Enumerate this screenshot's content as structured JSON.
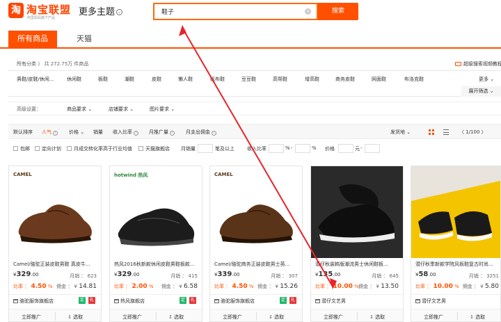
{
  "header": {
    "logo_glyph": "淘",
    "logo_text": "淘宝联盟",
    "logo_sub": "阿里妈妈旗下产品",
    "theme_link": "更多主题",
    "theme_chevron": "⌄",
    "search_value": "鞋子",
    "clear_glyph": "×",
    "search_button": "搜索"
  },
  "tabs": {
    "all": "所有商品",
    "tmall": "天猫"
  },
  "breadcrumb": {
    "all_categories": "所有分类",
    "separator": "〉",
    "count": "共 272.75万 件商品"
  },
  "super_search": "超级搜索视频教程",
  "categories": [
    "男鞋/皮鞋/休闲...",
    "休闲鞋",
    "板鞋",
    "潮鞋",
    "皮鞋",
    "懒人鞋",
    "帆布鞋",
    "豆豆鞋",
    "高帮鞋",
    "增高鞋",
    "商务皮鞋",
    "网面鞋",
    "布洛克鞋"
  ],
  "cat_more": "更多",
  "cat_more_chevron": "⌄",
  "expand_filter": "展开筛选 ⌄",
  "advanced": {
    "label": "高级设置：",
    "items": [
      "商品要求 ⌄",
      "店铺要求 ⌄",
      "图片要求 ⌄"
    ]
  },
  "sortbar": {
    "default": "默认排序",
    "popularity": "人气",
    "price": "价格 ⌄",
    "sales": "销量",
    "income_ratio": "收入比率",
    "monthly_promo": "月推广量",
    "monthly_payout": "月支出佣金",
    "ship_from": "发货地 ⌄",
    "pager": "〈   1/100   〉",
    "info_glyph": "i"
  },
  "filters": {
    "free_shipping": "包邮",
    "targeted_plan": "定向计划",
    "monthly_conversion": "月成交转化率高于行业均值",
    "tmall_flagship": "天猫旗舰店",
    "monthly_sales": "月销量",
    "pen_above": "笔及以上",
    "income_ratio": "收入比率",
    "percent1": "%",
    "dash1": "-",
    "percent2": "%",
    "price": "价格",
    "yuan": "元",
    "dash2": "-"
  },
  "products": [
    {
      "brand": "CAMEL",
      "title": "Camel/骆驼正装皮鞋男鞋 真皮牛...",
      "price": "329",
      "price_dec": ".00",
      "sales": "月销 ： 623",
      "ratio_label": "比率 ：",
      "ratio": "4.50",
      "ratio_unit": " %",
      "commission_label": "佣金 ：",
      "commission": "14.81",
      "shop": "骆驼服饰旗舰店",
      "badge1": "定",
      "badge2": "礼",
      "promote": "立即推广",
      "select": "选取"
    },
    {
      "brand": "hotwind 热风",
      "title": "热风2016秋新款休闲皮鞋男鞋板款...",
      "price": "329",
      "price_dec": ".00",
      "sales": "月销 ： 415",
      "ratio_label": "比率 ：",
      "ratio": "2.00",
      "ratio_unit": " %",
      "commission_label": "佣金 ：",
      "commission": "6.58",
      "shop": "热风旗舰店",
      "badge1": "定",
      "badge2": "礼",
      "promote": "立即推广",
      "select": "选取"
    },
    {
      "brand": "CAMEL",
      "title": "Camel/骆驼商务正装皮鞋男士英...",
      "price": "339",
      "price_dec": ".00",
      "sales": "月销 ： 307",
      "ratio_label": "比率 ：",
      "ratio": "4.50",
      "ratio_unit": " %",
      "commission_label": "佣金 ：",
      "commission": "15.26",
      "shop": "骆驼服饰旗舰店",
      "badge1": "定",
      "badge2": "礼",
      "promote": "立即推广",
      "select": "选取"
    },
    {
      "brand": "",
      "title": "潜仔秋装韩版潮流男士休闲鞋板...",
      "price": "135",
      "price_dec": ".00",
      "sales": "月销 ： 645",
      "ratio_label": "比率 ：",
      "ratio": "10.00",
      "ratio_unit": " %",
      "commission_label": "佣金 ：",
      "commission": "13.50",
      "shop": "潜仔文艺男",
      "badge1": "",
      "badge2": "",
      "promote": "立即推广",
      "select": "选取"
    },
    {
      "brand": "",
      "title": "潜仔秋季新款学院风板鞋复古时尚...",
      "price": "58",
      "price_dec": ".00",
      "sales": "月销 ： 3251",
      "ratio_label": "比率 ：",
      "ratio": "10.00",
      "ratio_unit": " %",
      "commission_label": "佣金 ：",
      "commission": "5.80",
      "shop": "潜仔文艺男",
      "badge1": "",
      "badge2": "",
      "promote": "立即推广",
      "select": "选取"
    }
  ],
  "colors": {
    "accent": "#ff5000",
    "annotation": "#e8232a"
  }
}
